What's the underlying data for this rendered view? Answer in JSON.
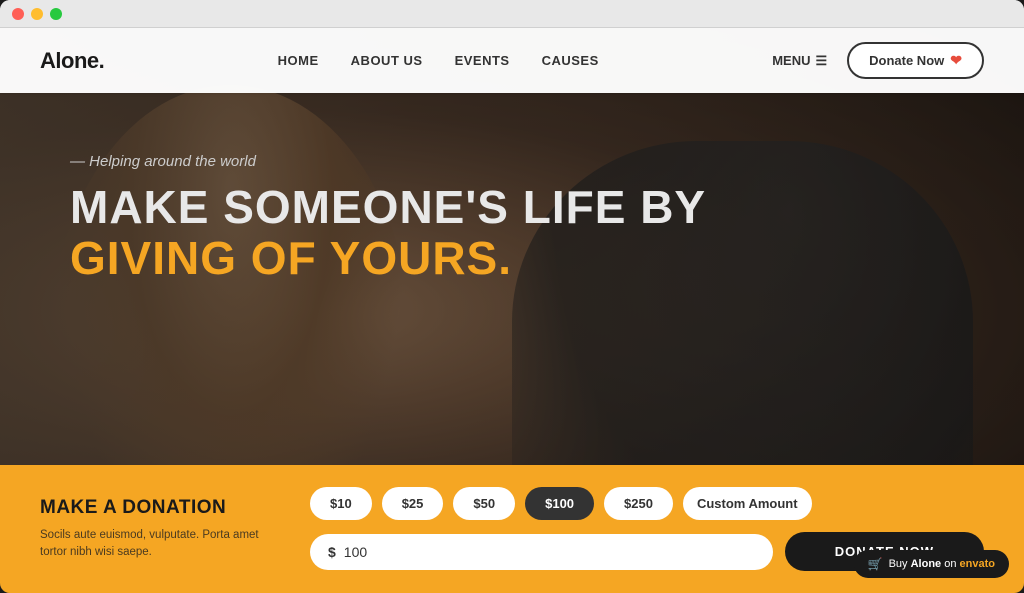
{
  "window": {
    "dots": [
      "red",
      "yellow",
      "green"
    ]
  },
  "navbar": {
    "logo": "Alone.",
    "links": [
      {
        "label": "HOME",
        "id": "home"
      },
      {
        "label": "ABOUT US",
        "id": "about"
      },
      {
        "label": "EVENTS",
        "id": "events"
      },
      {
        "label": "CAUSES",
        "id": "causes"
      }
    ],
    "menu_label": "MENU",
    "donate_button": "Donate Now"
  },
  "hero": {
    "subtitle": "Helping around the world",
    "title_line1": "MAKE SOMEONE'S LIFE BY",
    "title_line2": "GIVING OF YOURS."
  },
  "donation": {
    "title": "MAKE A DONATION",
    "description": "Socils aute euismod, vulputate. Porta amet tortor nibh wisi saepe.",
    "amounts": [
      {
        "label": "$10",
        "value": "10",
        "active": false
      },
      {
        "label": "$25",
        "value": "25",
        "active": false
      },
      {
        "label": "$50",
        "value": "50",
        "active": false
      },
      {
        "label": "$100",
        "value": "100",
        "active": true
      },
      {
        "label": "$250",
        "value": "250",
        "active": false
      },
      {
        "label": "Custom Amount",
        "value": "custom",
        "active": false
      }
    ],
    "input_prefix": "$",
    "input_value": "100",
    "button_label": "DONATE NOW"
  },
  "envato": {
    "label": "Buy",
    "brand": "Alone",
    "suffix": "on",
    "marketplace": "envato"
  }
}
